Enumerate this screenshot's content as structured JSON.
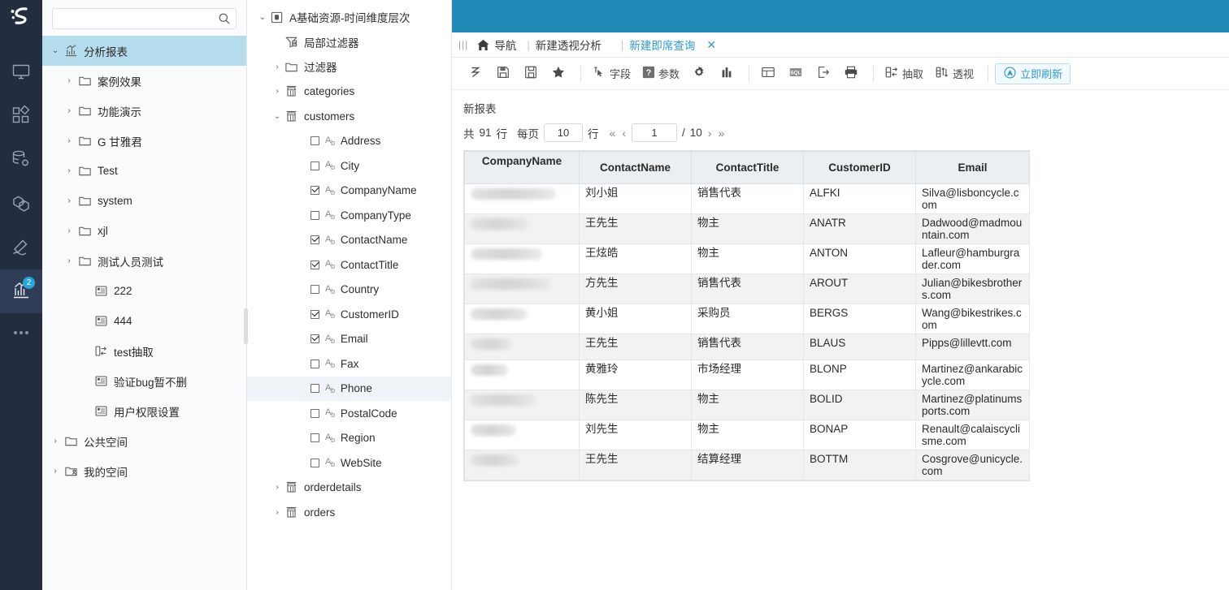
{
  "theme": {
    "accent": "#2089b5",
    "rail_bg": "#222d40",
    "link": "#2d9bd0",
    "selected_tree": "#b5dcec"
  },
  "rail": {
    "logo": "S",
    "items": [
      {
        "name": "monitor-icon",
        "label": "",
        "badge": ""
      },
      {
        "name": "blocks-icon",
        "label": "",
        "badge": ""
      },
      {
        "name": "database-settings-icon",
        "label": "",
        "badge": ""
      },
      {
        "name": "cube-icon",
        "label": "",
        "badge": ""
      },
      {
        "name": "hammer-icon",
        "label": "",
        "badge": ""
      },
      {
        "name": "chart-icon",
        "label": "",
        "badge": "2"
      }
    ],
    "more_label": "..."
  },
  "search": {
    "value": "",
    "placeholder": ""
  },
  "report_tree": [
    {
      "label": "分析报表",
      "level": 0,
      "icon": "chart-icon",
      "caret": "down",
      "selected": true
    },
    {
      "label": "案例效果",
      "level": 1,
      "icon": "folder-icon",
      "caret": "right",
      "selected": false
    },
    {
      "label": "功能演示",
      "level": 1,
      "icon": "folder-icon",
      "caret": "right",
      "selected": false
    },
    {
      "label": "G 甘雅君",
      "level": 1,
      "icon": "folder-icon",
      "caret": "right",
      "selected": false
    },
    {
      "label": "Test",
      "level": 1,
      "icon": "folder-icon",
      "caret": "right",
      "selected": false
    },
    {
      "label": "system",
      "level": 1,
      "icon": "folder-icon",
      "caret": "right",
      "selected": false
    },
    {
      "label": "xjl",
      "level": 1,
      "icon": "folder-icon",
      "caret": "right",
      "selected": false
    },
    {
      "label": "测试人员测试",
      "level": 1,
      "icon": "folder-icon",
      "caret": "right",
      "selected": false
    },
    {
      "label": "222",
      "level": 2,
      "icon": "report-icon",
      "caret": "none",
      "selected": false
    },
    {
      "label": "444",
      "level": 2,
      "icon": "report-icon",
      "caret": "none",
      "selected": false
    },
    {
      "label": "test抽取",
      "level": 2,
      "icon": "extract-icon",
      "caret": "none",
      "selected": false
    },
    {
      "label": "验证bug暂不删",
      "level": 2,
      "icon": "report-icon",
      "caret": "none",
      "selected": false
    },
    {
      "label": "用户权限设置",
      "level": 2,
      "icon": "report-icon",
      "caret": "none",
      "selected": false
    },
    {
      "label": "公共空间",
      "level": 0,
      "icon": "folder-icon",
      "caret": "right",
      "selected": false
    },
    {
      "label": "我的空间",
      "level": 0,
      "icon": "my-folder-icon",
      "caret": "right",
      "selected": false
    }
  ],
  "field_tree": [
    {
      "label": "A基础资源-时间维度层次",
      "level": 0,
      "icon": "dataset-icon",
      "caret": "down",
      "check": "none",
      "hl": false
    },
    {
      "label": "局部过滤器",
      "level": 1,
      "icon": "local-filter-icon",
      "caret": "none",
      "check": "none",
      "hl": false
    },
    {
      "label": "过滤器",
      "level": 1,
      "icon": "folder-icon",
      "caret": "right",
      "check": "none",
      "hl": false
    },
    {
      "label": "categories",
      "level": 1,
      "icon": "table-icon",
      "caret": "right",
      "check": "none",
      "hl": false
    },
    {
      "label": "customers",
      "level": 1,
      "icon": "table-icon",
      "caret": "down",
      "check": "none",
      "hl": false
    },
    {
      "label": "Address",
      "level": 2,
      "icon": "text-field-icon",
      "caret": "none",
      "check": "off",
      "hl": false
    },
    {
      "label": "City",
      "level": 2,
      "icon": "text-field-icon",
      "caret": "none",
      "check": "off",
      "hl": false
    },
    {
      "label": "CompanyName",
      "level": 2,
      "icon": "text-field-icon",
      "caret": "none",
      "check": "on",
      "hl": false
    },
    {
      "label": "CompanyType",
      "level": 2,
      "icon": "text-field-icon",
      "caret": "none",
      "check": "off",
      "hl": false
    },
    {
      "label": "ContactName",
      "level": 2,
      "icon": "text-field-icon",
      "caret": "none",
      "check": "on",
      "hl": false
    },
    {
      "label": "ContactTitle",
      "level": 2,
      "icon": "text-field-icon",
      "caret": "none",
      "check": "on",
      "hl": false
    },
    {
      "label": "Country",
      "level": 2,
      "icon": "text-field-icon",
      "caret": "none",
      "check": "off",
      "hl": false
    },
    {
      "label": "CustomerID",
      "level": 2,
      "icon": "text-field-icon",
      "caret": "none",
      "check": "on",
      "hl": false
    },
    {
      "label": "Email",
      "level": 2,
      "icon": "text-field-icon",
      "caret": "none",
      "check": "on",
      "hl": false
    },
    {
      "label": "Fax",
      "level": 2,
      "icon": "text-field-icon",
      "caret": "none",
      "check": "off",
      "hl": false
    },
    {
      "label": "Phone",
      "level": 2,
      "icon": "text-field-icon",
      "caret": "none",
      "check": "off",
      "hl": true
    },
    {
      "label": "PostalCode",
      "level": 2,
      "icon": "text-field-icon",
      "caret": "none",
      "check": "off",
      "hl": false
    },
    {
      "label": "Region",
      "level": 2,
      "icon": "text-field-icon",
      "caret": "none",
      "check": "off",
      "hl": false
    },
    {
      "label": "WebSite",
      "level": 2,
      "icon": "text-field-icon",
      "caret": "none",
      "check": "off",
      "hl": false
    },
    {
      "label": "orderdetails",
      "level": 1,
      "icon": "table-icon",
      "caret": "right",
      "check": "none",
      "hl": false
    },
    {
      "label": "orders",
      "level": 1,
      "icon": "table-icon",
      "caret": "right",
      "check": "none",
      "hl": false
    }
  ],
  "breadcrumb": {
    "menu_icon": "hamburger-icon",
    "home_icon": "home-icon",
    "home_label": "导航",
    "items": [
      {
        "label": "新建透视分析",
        "active": false
      },
      {
        "label": "新建即席查询",
        "active": true
      }
    ],
    "close_label": "✕"
  },
  "toolbar": {
    "buttons": [
      {
        "name": "refresh-arrow-icon",
        "label": "",
        "icon": "refresh-z",
        "type": "icon"
      },
      {
        "name": "save-icon",
        "label": "",
        "icon": "save",
        "type": "icon"
      },
      {
        "name": "save-as-icon",
        "label": "",
        "icon": "save-as",
        "type": "icon"
      },
      {
        "name": "favorite-star-icon",
        "label": "",
        "icon": "star",
        "type": "icon"
      },
      {
        "name": "divider",
        "label": "",
        "icon": "divider",
        "type": "divider"
      },
      {
        "name": "fields-button",
        "label": "字段",
        "icon": "cursor-field",
        "type": "text"
      },
      {
        "name": "parameters-button",
        "label": "参数",
        "icon": "question-box",
        "type": "text"
      },
      {
        "name": "settings-gear-icon",
        "label": "",
        "icon": "gear",
        "type": "icon"
      },
      {
        "name": "chart-bar-icon",
        "label": "",
        "icon": "bars",
        "type": "icon"
      },
      {
        "name": "divider",
        "label": "",
        "icon": "divider",
        "type": "divider"
      },
      {
        "name": "layout-icon",
        "label": "",
        "icon": "layout",
        "type": "icon"
      },
      {
        "name": "sql-icon",
        "label": "",
        "icon": "sql",
        "type": "icon"
      },
      {
        "name": "export-icon",
        "label": "",
        "icon": "export",
        "type": "icon"
      },
      {
        "name": "print-icon",
        "label": "",
        "icon": "print",
        "type": "icon"
      },
      {
        "name": "divider",
        "label": "",
        "icon": "divider",
        "type": "divider"
      },
      {
        "name": "extract-button",
        "label": "抽取",
        "icon": "extract",
        "type": "text"
      },
      {
        "name": "pivot-button",
        "label": "透视",
        "icon": "pivot",
        "type": "text"
      },
      {
        "name": "divider",
        "label": "",
        "icon": "divider",
        "type": "divider"
      },
      {
        "name": "refresh-now-button",
        "label": "立即刷新",
        "icon": "auto-refresh",
        "type": "primary"
      }
    ]
  },
  "report": {
    "title": "新报表",
    "pager": {
      "total_prefix": "共",
      "total_rows": "91",
      "total_suffix": "行",
      "per_page_label": "每页",
      "per_page_value": "10",
      "per_page_unit": "行",
      "first_icon": "«",
      "prev_icon": "‹",
      "current_page": "1",
      "page_sep": "/",
      "total_pages": "10",
      "next_icon": "›",
      "last_icon": "»"
    }
  },
  "chart_data": {
    "type": "table",
    "title": "新报表",
    "columns": [
      "CompanyName",
      "ContactName",
      "ContactTitle",
      "CustomerID",
      "Email"
    ],
    "rows": [
      {
        "CompanyName": "",
        "CompanyName_redacted": true,
        "ContactName": "刘小姐",
        "ContactTitle": "销售代表",
        "CustomerID": "ALFKI",
        "Email": "Silva@lisboncycle.com"
      },
      {
        "CompanyName": "",
        "CompanyName_redacted": true,
        "ContactName": "王先生",
        "ContactTitle": "物主",
        "CustomerID": "ANATR",
        "Email": "Dadwood@madmountain.com"
      },
      {
        "CompanyName": "",
        "CompanyName_redacted": true,
        "ContactName": "王炫皓",
        "ContactTitle": "物主",
        "CustomerID": "ANTON",
        "Email": "Lafleur@hamburgrader.com"
      },
      {
        "CompanyName": "",
        "CompanyName_redacted": true,
        "ContactName": "方先生",
        "ContactTitle": "销售代表",
        "CustomerID": "AROUT",
        "Email": "Julian@bikesbrothers.com"
      },
      {
        "CompanyName": "",
        "CompanyName_redacted": true,
        "ContactName": "黄小姐",
        "ContactTitle": "采购员",
        "CustomerID": "BERGS",
        "Email": "Wang@bikestrikes.com"
      },
      {
        "CompanyName": "",
        "CompanyName_redacted": true,
        "ContactName": "王先生",
        "ContactTitle": "销售代表",
        "CustomerID": "BLAUS",
        "Email": "Pipps@lillevtt.com"
      },
      {
        "CompanyName": "",
        "CompanyName_redacted": true,
        "ContactName": "黄雅玲",
        "ContactTitle": "市场经理",
        "CustomerID": "BLONP",
        "Email": "Martinez@ankarabicycle.com"
      },
      {
        "CompanyName": "",
        "CompanyName_redacted": true,
        "ContactName": "陈先生",
        "ContactTitle": "物主",
        "CustomerID": "BOLID",
        "Email": "Martinez@platinumsports.com"
      },
      {
        "CompanyName": "",
        "CompanyName_redacted": true,
        "ContactName": "刘先生",
        "ContactTitle": "物主",
        "CustomerID": "BONAP",
        "Email": "Renault@calaiscyclisme.com"
      },
      {
        "CompanyName": "",
        "CompanyName_redacted": true,
        "ContactName": "王先生",
        "ContactTitle": "结算经理",
        "CustomerID": "BOTTM",
        "Email": "Cosgrove@unicycle.com"
      }
    ],
    "total_rows": 91,
    "page": 1,
    "pages": 10,
    "per_page": 10
  }
}
